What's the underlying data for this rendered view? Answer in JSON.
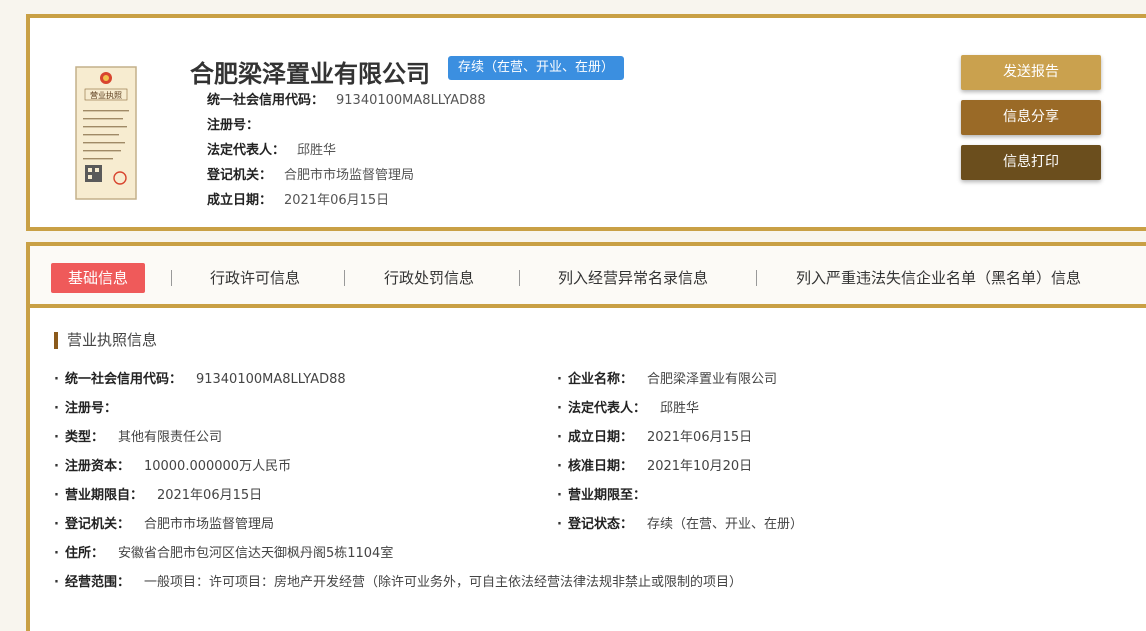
{
  "company": {
    "name": "合肥梁泽置业有限公司",
    "status": "存续（在营、开业、在册）",
    "info": [
      {
        "label": "统一社会信用代码：",
        "value": "91340100MA8LLYAD88"
      },
      {
        "label": "注册号：",
        "value": ""
      },
      {
        "label": "法定代表人：",
        "value": "邱胜华"
      },
      {
        "label": "登记机关：",
        "value": "合肥市市场监督管理局"
      },
      {
        "label": "成立日期：",
        "value": "2021年06月15日"
      }
    ]
  },
  "license_image": {
    "title": "营业执照",
    "icon": "business-license-icon"
  },
  "actions": {
    "report": "发送报告",
    "share": "信息分享",
    "print": "信息打印"
  },
  "tabs": [
    {
      "label": "基础信息",
      "active": true
    },
    {
      "label": "行政许可信息",
      "active": false
    },
    {
      "label": "行政处罚信息",
      "active": false
    },
    {
      "label": "列入经营异常名录信息",
      "active": false
    },
    {
      "label": "列入严重违法失信企业名单（黑名单）信息",
      "active": false
    }
  ],
  "section": {
    "title": "营业执照信息",
    "left": [
      {
        "label": "统一社会信用代码：",
        "value": "91340100MA8LLYAD88"
      },
      {
        "label": "注册号：",
        "value": ""
      },
      {
        "label": "类型：",
        "value": "其他有限责任公司"
      },
      {
        "label": "注册资本：",
        "value": "10000.000000万人民币"
      },
      {
        "label": "营业期限自：",
        "value": "2021年06月15日"
      },
      {
        "label": "登记机关：",
        "value": "合肥市市场监督管理局"
      },
      {
        "label": "住所：",
        "value": "安徽省合肥市包河区信达天御枫丹阁5栋1104室"
      },
      {
        "label": "经营范围：",
        "value": "一般项目：许可项目：房地产开发经营（除许可业务外，可自主依法经营法律法规非禁止或限制的项目）"
      }
    ],
    "right": [
      {
        "label": "企业名称：",
        "value": "合肥梁泽置业有限公司"
      },
      {
        "label": "法定代表人：",
        "value": "邱胜华"
      },
      {
        "label": "成立日期：",
        "value": "2021年06月15日"
      },
      {
        "label": "核准日期：",
        "value": "2021年10月20日"
      },
      {
        "label": "营业期限至：",
        "value": ""
      },
      {
        "label": "登记状态：",
        "value": "存续（在营、开业、在册）"
      }
    ]
  },
  "colors": {
    "gold": "#c9a045",
    "active_tab": "#ef5a5a",
    "status_badge": "#3b8fe0"
  }
}
